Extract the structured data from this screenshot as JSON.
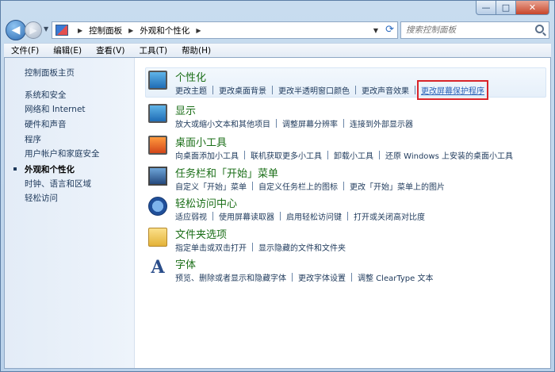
{
  "window": {
    "controls": {
      "minimize": "—",
      "maximize": "□",
      "close": "✕"
    }
  },
  "navigation": {
    "back_icon": "◀",
    "forward_icon": "▶",
    "dropdown_icon": "▼",
    "breadcrumb": [
      "控制面板",
      "外观和个性化"
    ],
    "refresh_icon": "⟳",
    "search_placeholder": "搜索控制面板"
  },
  "menu": {
    "items": [
      "文件(F)",
      "编辑(E)",
      "查看(V)",
      "工具(T)",
      "帮助(H)"
    ]
  },
  "sidebar": {
    "items": [
      {
        "label": "控制面板主页"
      },
      {
        "label": "系统和安全"
      },
      {
        "label": "网络和 Internet"
      },
      {
        "label": "硬件和声音"
      },
      {
        "label": "程序"
      },
      {
        "label": "用户帐户和家庭安全"
      },
      {
        "label": "外观和个性化",
        "current": true
      },
      {
        "label": "时钟、语言和区域"
      },
      {
        "label": "轻松访问"
      }
    ]
  },
  "categories": [
    {
      "title": "个性化",
      "icon": "monitor-icon",
      "links": [
        "更改主题",
        "更改桌面背景",
        "更改半透明窗口颜色",
        "更改声音效果",
        "更改屏幕保护程序"
      ],
      "highlighted_link": 4
    },
    {
      "title": "显示",
      "icon": "display-icon",
      "links": [
        "放大或缩小文本和其他项目",
        "调整屏幕分辨率",
        "连接到外部显示器"
      ]
    },
    {
      "title": "桌面小工具",
      "icon": "gadget-icon",
      "links": [
        "向桌面添加小工具",
        "联机获取更多小工具",
        "卸载小工具",
        "还原 Windows 上安装的桌面小工具"
      ]
    },
    {
      "title": "任务栏和「开始」菜单",
      "icon": "taskbar-icon",
      "links": [
        "自定义「开始」菜单",
        "自定义任务栏上的图标",
        "更改「开始」菜单上的图片"
      ]
    },
    {
      "title": "轻松访问中心",
      "icon": "accessibility-icon",
      "links": [
        "适应弱视",
        "使用屏幕读取器",
        "启用轻松访问键",
        "打开或关闭高对比度"
      ]
    },
    {
      "title": "文件夹选项",
      "icon": "folder-icon",
      "links": [
        "指定单击或双击打开",
        "显示隐藏的文件和文件夹"
      ]
    },
    {
      "title": "字体",
      "icon": "font-icon",
      "icon_text": "A",
      "links": [
        "预览、删除或者显示和隐藏字体",
        "更改字体设置",
        "调整 ClearType 文本"
      ]
    }
  ],
  "colors": {
    "category_title": "#1a6e17",
    "link": "#1e395b",
    "highlight_box": "#d9242a"
  }
}
